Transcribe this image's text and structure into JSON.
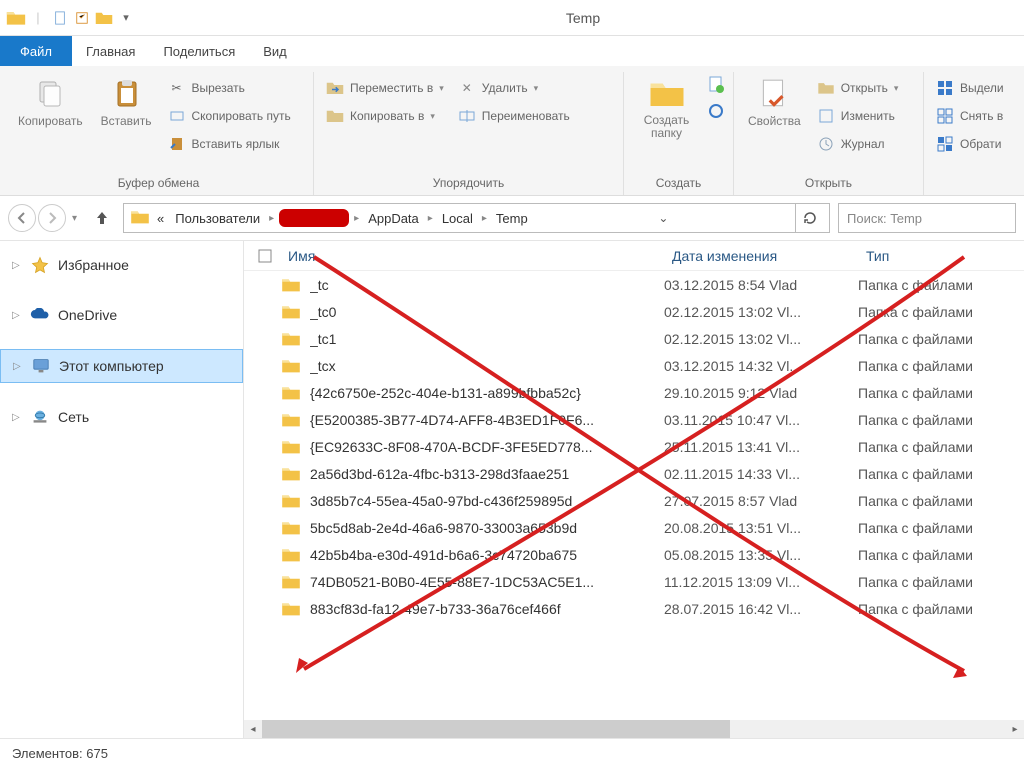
{
  "title": "Temp",
  "tabs": {
    "file": "Файл",
    "home": "Главная",
    "share": "Поделиться",
    "view": "Вид"
  },
  "ribbon": {
    "clipboard": {
      "copy": "Копировать",
      "paste": "Вставить",
      "cut": "Вырезать",
      "copy_path": "Скопировать путь",
      "paste_shortcut": "Вставить ярлык",
      "label": "Буфер обмена"
    },
    "organize": {
      "move_to": "Переместить в",
      "copy_to": "Копировать в",
      "delete": "Удалить",
      "rename": "Переименовать",
      "label": "Упорядочить"
    },
    "new": {
      "new_folder": "Создать папку",
      "label": "Создать"
    },
    "open": {
      "properties": "Свойства",
      "open": "Открыть",
      "edit": "Изменить",
      "history": "Журнал",
      "label": "Открыть"
    },
    "select": {
      "select_all": "Выдели",
      "select_none": "Снять в",
      "invert": "Обрати"
    }
  },
  "breadcrumb": {
    "root": "«",
    "users": "Пользователи",
    "appdata": "AppData",
    "local": "Local",
    "temp": "Temp"
  },
  "search_placeholder": "Поиск: Temp",
  "sidebar": {
    "favorites": "Избранное",
    "onedrive": "OneDrive",
    "this_pc": "Этот компьютер",
    "network": "Сеть"
  },
  "columns": {
    "name": "Имя",
    "date": "Дата изменения",
    "type": "Тип"
  },
  "type_folder": "Папка с файлами",
  "rows": [
    {
      "name": "_tc",
      "date": "03.12.2015 8:54 Vlad"
    },
    {
      "name": "_tc0",
      "date": "02.12.2015 13:02 Vl..."
    },
    {
      "name": "_tc1",
      "date": "02.12.2015 13:02 Vl..."
    },
    {
      "name": "_tcx",
      "date": "03.12.2015 14:32 Vl..."
    },
    {
      "name": "{42c6750e-252c-404e-b131-a899bfbba52c}",
      "date": "29.10.2015 9:12 Vlad"
    },
    {
      "name": "{E5200385-3B77-4D74-AFF8-4B3ED1F0F6...",
      "date": "03.11.2015 10:47 Vl..."
    },
    {
      "name": "{EC92633C-8F08-470A-BCDF-3FE5ED778...",
      "date": "25.11.2015 13:41 Vl..."
    },
    {
      "name": "2a56d3bd-612a-4fbc-b313-298d3faae251",
      "date": "02.11.2015 14:33 Vl..."
    },
    {
      "name": "3d85b7c4-55ea-45a0-97bd-c436f259895d",
      "date": "27.07.2015 8:57 Vlad"
    },
    {
      "name": "5bc5d8ab-2e4d-46a6-9870-33003a653b9d",
      "date": "20.08.2015 13:51 Vl..."
    },
    {
      "name": "42b5b4ba-e30d-491d-b6a6-3c74720ba675",
      "date": "05.08.2015 13:35 Vl..."
    },
    {
      "name": "74DB0521-B0B0-4E55-88E7-1DC53AC5E1...",
      "date": "11.12.2015 13:09 Vl..."
    },
    {
      "name": "883cf83d-fa12-49e7-b733-36a76cef466f",
      "date": "28.07.2015 16:42 Vl..."
    }
  ],
  "status": {
    "elements_label": "Элементов:",
    "count": "675"
  }
}
